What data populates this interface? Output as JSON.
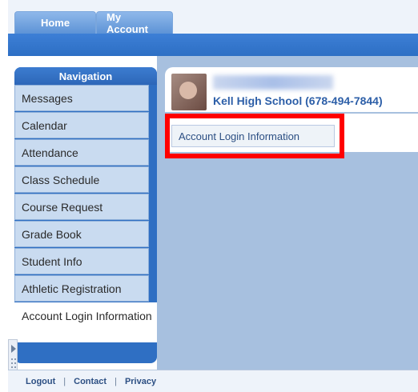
{
  "tabs": [
    {
      "label": "Home"
    },
    {
      "label": "My Account"
    }
  ],
  "navigation": {
    "title": "Navigation",
    "items": [
      {
        "label": "Messages"
      },
      {
        "label": "Calendar"
      },
      {
        "label": "Attendance"
      },
      {
        "label": "Class Schedule"
      },
      {
        "label": "Course Request"
      },
      {
        "label": "Grade Book"
      },
      {
        "label": "Student Info"
      },
      {
        "label": "Athletic Registration"
      },
      {
        "label": "Account Login Information"
      }
    ]
  },
  "profile": {
    "school": "Kell High School (678-494-7844)"
  },
  "account_section": {
    "button_label": "Account Login Information"
  },
  "footer": {
    "links": [
      {
        "label": "Logout"
      },
      {
        "label": "Contact"
      },
      {
        "label": "Privacy"
      }
    ]
  },
  "colors": {
    "highlight": "#ff0000",
    "brand_blue": "#2f6fc3"
  }
}
